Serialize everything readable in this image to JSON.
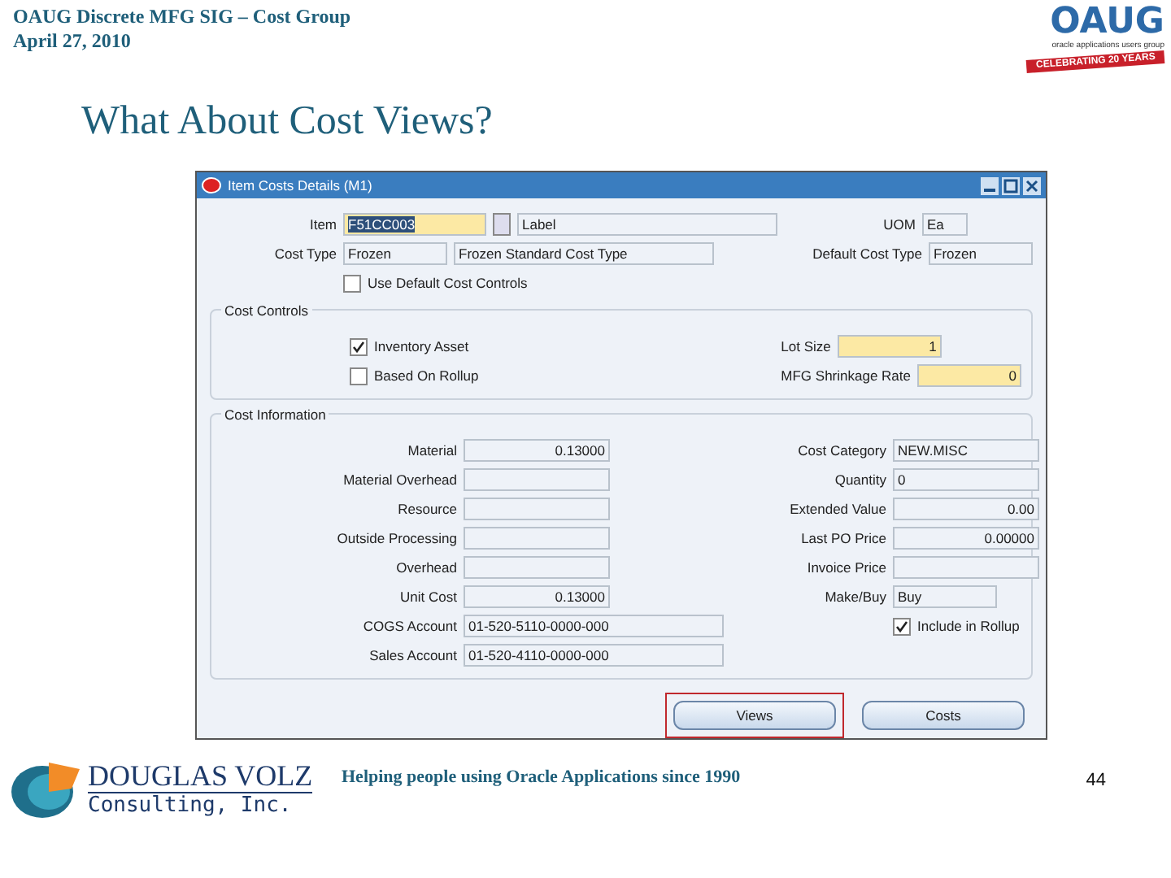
{
  "header": {
    "line1": "OAUG Discrete MFG SIG – Cost Group",
    "line2": "April 27, 2010"
  },
  "oaug_logo": {
    "wordmark": "OAUG",
    "tagline": "oracle applications users group",
    "ribbon": "CELEBRATING 20 YEARS"
  },
  "title": "What About Cost Views?",
  "window": {
    "title": "Item Costs Details (M1)",
    "item": {
      "label": "Item",
      "value": "F51CC003",
      "selected": true,
      "description": "Label"
    },
    "uom": {
      "label": "UOM",
      "value": "Ea"
    },
    "cost_type": {
      "label": "Cost Type",
      "value": "Frozen",
      "description": "Frozen Standard Cost Type"
    },
    "default_cost_type": {
      "label": "Default Cost Type",
      "value": "Frozen"
    },
    "use_default_controls": {
      "label": "Use Default Cost Controls",
      "checked": false
    },
    "cost_controls": {
      "title": "Cost Controls",
      "checkboxes": [
        {
          "label": "Inventory Asset",
          "checked": true
        },
        {
          "label": "Based On Rollup",
          "checked": false
        }
      ],
      "fields": [
        {
          "label": "Lot Size",
          "value": "1",
          "required": true
        },
        {
          "label": "MFG Shrinkage Rate",
          "value": "0",
          "required": true
        }
      ]
    },
    "cost_information": {
      "title": "Cost Information",
      "left": [
        {
          "label": "Material",
          "value": "0.13000",
          "kind": "number"
        },
        {
          "label": "Material Overhead",
          "kind": "number"
        },
        {
          "label": "Resource",
          "kind": "number"
        },
        {
          "label": "Outside Processing",
          "kind": "number"
        },
        {
          "label": "Overhead",
          "kind": "number"
        },
        {
          "label": "Unit Cost",
          "value": "0.13000",
          "kind": "number"
        },
        {
          "label": "COGS Account",
          "value": "01-520-5110-0000-000",
          "kind": "account"
        },
        {
          "label": "Sales Account",
          "value": "01-520-4110-0000-000",
          "kind": "account"
        }
      ],
      "right": [
        {
          "label": "Cost Category",
          "value": "NEW.MISC",
          "kind": "text"
        },
        {
          "label": "Quantity",
          "value": "0",
          "kind": "text"
        },
        {
          "label": "Extended Value",
          "value": "0.00",
          "kind": "number"
        },
        {
          "label": "Last PO Price",
          "value": "0.00000",
          "kind": "number"
        },
        {
          "label": "Invoice Price",
          "kind": "number"
        },
        {
          "label": "Make/Buy",
          "value": "Buy",
          "kind": "short"
        }
      ],
      "include_in_rollup": {
        "label": "Include in Rollup",
        "checked": true
      }
    },
    "buttons": [
      {
        "label": "Views",
        "highlighted": true
      },
      {
        "label": "Costs",
        "highlighted": false
      }
    ]
  },
  "footer": {
    "logo": {
      "name": "DOUGLAS VOLZ",
      "subtitle": "Consulting, Inc."
    },
    "tagline": "Helping people using Oracle Applications since 1990",
    "page": "44"
  }
}
